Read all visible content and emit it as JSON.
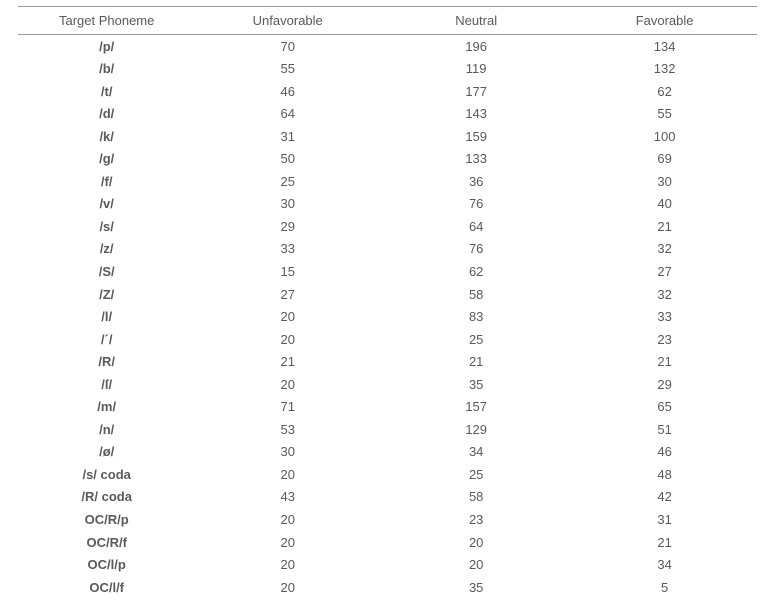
{
  "chart_data": {
    "type": "table",
    "title": "",
    "columns": [
      "Target Phoneme",
      "Unfavorable",
      "Neutral",
      "Favorable"
    ],
    "rows": [
      {
        "phoneme": "/p/",
        "unfavorable": 70,
        "neutral": 196,
        "favorable": 134
      },
      {
        "phoneme": "/b/",
        "unfavorable": 55,
        "neutral": 119,
        "favorable": 132
      },
      {
        "phoneme": "/t/",
        "unfavorable": 46,
        "neutral": 177,
        "favorable": 62
      },
      {
        "phoneme": "/d/",
        "unfavorable": 64,
        "neutral": 143,
        "favorable": 55
      },
      {
        "phoneme": "/k/",
        "unfavorable": 31,
        "neutral": 159,
        "favorable": 100
      },
      {
        "phoneme": "/g/",
        "unfavorable": 50,
        "neutral": 133,
        "favorable": 69
      },
      {
        "phoneme": "/f/",
        "unfavorable": 25,
        "neutral": 36,
        "favorable": 30
      },
      {
        "phoneme": "/v/",
        "unfavorable": 30,
        "neutral": 76,
        "favorable": 40
      },
      {
        "phoneme": "/s/",
        "unfavorable": 29,
        "neutral": 64,
        "favorable": 21
      },
      {
        "phoneme": "/z/",
        "unfavorable": 33,
        "neutral": 76,
        "favorable": 32
      },
      {
        "phoneme": "/S/",
        "unfavorable": 15,
        "neutral": 62,
        "favorable": 27
      },
      {
        "phoneme": "/Z/",
        "unfavorable": 27,
        "neutral": 58,
        "favorable": 32
      },
      {
        "phoneme": "/l/",
        "unfavorable": 20,
        "neutral": 83,
        "favorable": 33
      },
      {
        "phoneme": "/´/",
        "unfavorable": 20,
        "neutral": 25,
        "favorable": 23
      },
      {
        "phoneme": "/R/",
        "unfavorable": 21,
        "neutral": 21,
        "favorable": 21
      },
      {
        "phoneme": "/ſ/",
        "unfavorable": 20,
        "neutral": 35,
        "favorable": 29
      },
      {
        "phoneme": "/m/",
        "unfavorable": 71,
        "neutral": 157,
        "favorable": 65
      },
      {
        "phoneme": "/n/",
        "unfavorable": 53,
        "neutral": 129,
        "favorable": 51
      },
      {
        "phoneme": "/ø/",
        "unfavorable": 30,
        "neutral": 34,
        "favorable": 46
      },
      {
        "phoneme": "/s/ coda",
        "unfavorable": 20,
        "neutral": 25,
        "favorable": 48
      },
      {
        "phoneme": "/R/ coda",
        "unfavorable": 43,
        "neutral": 58,
        "favorable": 42
      },
      {
        "phoneme": "OC/R/p",
        "unfavorable": 20,
        "neutral": 23,
        "favorable": 31
      },
      {
        "phoneme": "OC/R/f",
        "unfavorable": 20,
        "neutral": 20,
        "favorable": 21
      },
      {
        "phoneme": "OC/l/p",
        "unfavorable": 20,
        "neutral": 20,
        "favorable": 34
      },
      {
        "phoneme": "OC/l/f",
        "unfavorable": 20,
        "neutral": 35,
        "favorable": 5
      }
    ]
  },
  "headers": {
    "phoneme": "Target Phoneme",
    "unfavorable": "Unfavorable",
    "neutral": "Neutral",
    "favorable": "Favorable"
  }
}
